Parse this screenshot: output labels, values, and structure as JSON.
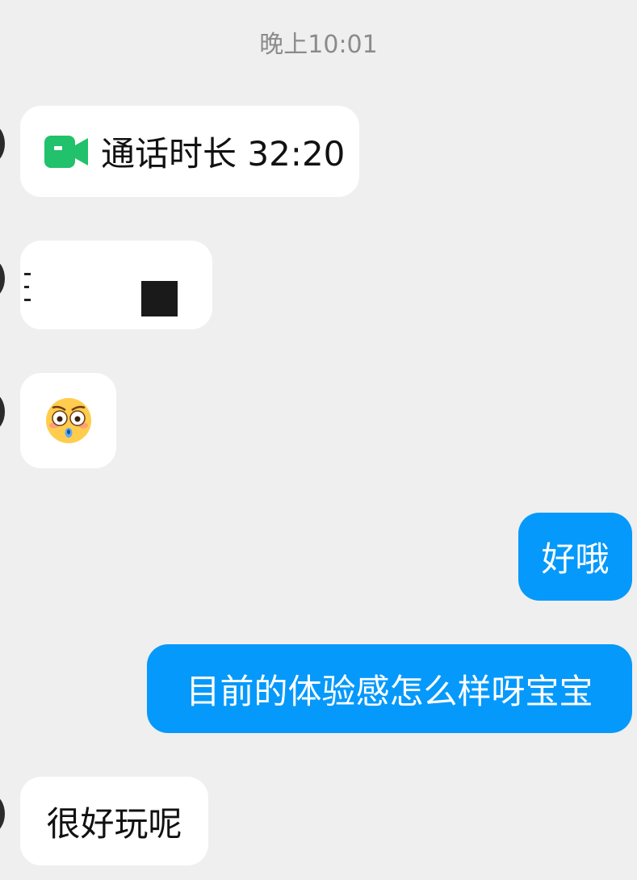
{
  "chat": {
    "timestamp": "晚上10:01",
    "messages": [
      {
        "side": "in",
        "type": "video-call",
        "icon": "video-camera-icon",
        "text": "通话时长 32:20"
      },
      {
        "side": "in",
        "type": "attachment",
        "text": "三"
      },
      {
        "side": "in",
        "type": "emoji",
        "icon": "flushed-face-emoji"
      },
      {
        "side": "out",
        "type": "text",
        "text": "好哦"
      },
      {
        "side": "out",
        "type": "text",
        "text": "目前的体验感怎么样呀宝宝"
      },
      {
        "side": "in",
        "type": "text",
        "text": "很好玩呢"
      }
    ]
  },
  "colors": {
    "background": "#efefef",
    "incoming_bubble": "#ffffff",
    "outgoing_bubble": "#0599fb",
    "call_icon": "#22c16b",
    "timestamp_text": "#8b8b8b"
  }
}
